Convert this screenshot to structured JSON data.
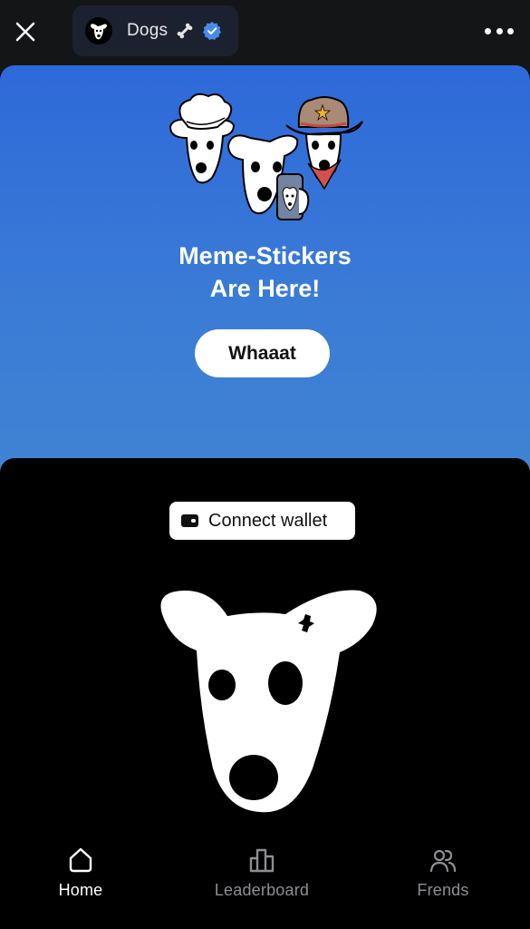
{
  "header": {
    "title": "Dogs",
    "title_emoji": "bone",
    "verified": true,
    "close_icon": "close-icon",
    "more_icon": "more-horizontal-icon"
  },
  "banner": {
    "title_line1": "Meme-Stickers",
    "title_line2": "Are Here!",
    "button_label": "Whaaat",
    "gradient_top": "#2e69d9",
    "gradient_bottom": "#4084d3"
  },
  "main": {
    "connect_wallet_label": "Connect wallet",
    "wallet_icon": "wallet-icon",
    "logo": "dogs-logo"
  },
  "tabbar": {
    "items": [
      {
        "label": "Home",
        "icon": "home-icon",
        "active": true
      },
      {
        "label": "Leaderboard",
        "icon": "leaderboard-icon",
        "active": false
      },
      {
        "label": "Frends",
        "icon": "friends-icon",
        "active": false
      }
    ]
  },
  "colors": {
    "topbar_bg": "#141517",
    "pill_bg": "#1c2130",
    "verified_blue": "#4a8be8",
    "inactive_tab": "#8e8e93"
  }
}
